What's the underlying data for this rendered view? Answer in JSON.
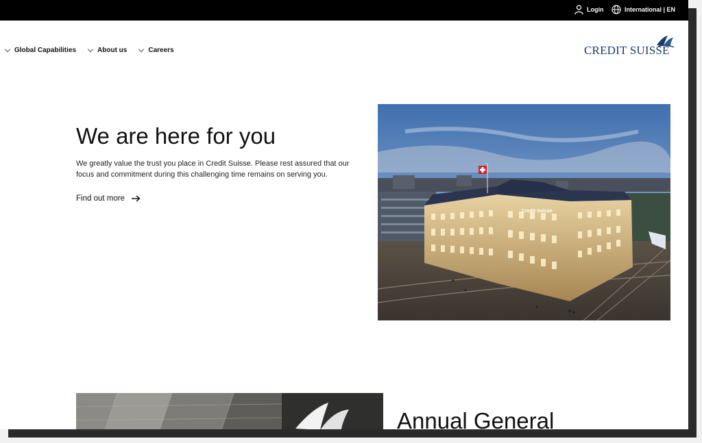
{
  "topbar": {
    "login_label": "Login",
    "region_label": "International | EN",
    "icons": [
      "user-icon",
      "globe-icon"
    ]
  },
  "nav": {
    "items": [
      {
        "label": "Global Capabilities"
      },
      {
        "label": "About us"
      },
      {
        "label": "Careers"
      }
    ]
  },
  "logo": {
    "text": "CREDIT SUISSE",
    "color": "#1b3a6b"
  },
  "hero": {
    "title": "We are here for you",
    "body": "We greatly value the trust you place in Credit Suisse. Please rest assured that our focus and commitment during this challenging time remains on serving you.",
    "link_label": "Find out more",
    "photo_caption": "Credit Suisse"
  },
  "agm": {
    "title": "Annual General"
  }
}
